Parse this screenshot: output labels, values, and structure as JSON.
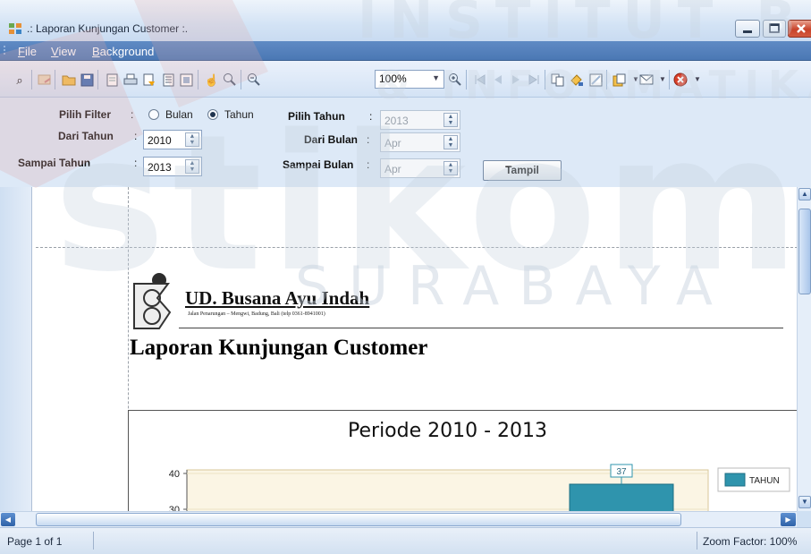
{
  "window": {
    "title": ".: Laporan Kunjungan Customer :.",
    "app_icon": "form-icon"
  },
  "menu": {
    "items": [
      {
        "accel": "F",
        "rest": "ile"
      },
      {
        "accel": "V",
        "rest": "iew"
      },
      {
        "accel": "B",
        "rest": "ackground"
      }
    ]
  },
  "toolbar": {
    "zoom_value": "100%",
    "icons": [
      "find-icon",
      "group-tree-icon",
      "open-icon",
      "save-icon",
      "page-setup-icon",
      "print-icon",
      "quick-print-icon",
      "header-footer-icon",
      "scale-icon",
      "hand-tool-icon",
      "magnifier-icon",
      "zoom-out-icon",
      "zoom-in-icon",
      "first-page-icon",
      "previous-page-icon",
      "next-page-icon",
      "last-page-icon",
      "multiple-pages-icon",
      "background-color-icon",
      "watermark-icon",
      "export-icon",
      "send-email-icon",
      "close-preview-icon"
    ]
  },
  "filter": {
    "filter_label": "Pilih Filter",
    "option_month": "Bulan",
    "option_year": "Tahun",
    "selected_option": "Tahun",
    "from_year_label": "Dari Tahun",
    "from_year_value": "2010",
    "to_year_label": "Sampai Tahun",
    "to_year_value": "2013",
    "pick_year_label": "Pilih Tahun",
    "pick_year_value": "2013",
    "from_month_label": "Dari Bulan",
    "from_month_value": "Apr",
    "to_month_label": "Sampai Bulan",
    "to_month_value": "Apr",
    "show_button": "Tampil"
  },
  "report": {
    "company_name": "UD. Busana Ayu Indah",
    "company_address": "Jalan Penarungan – Mengwi, Badung, Bali (telp 0361-8941001)",
    "title": "Laporan Kunjungan Customer"
  },
  "chart_data": {
    "type": "bar",
    "title": "Periode 2010 - 2013",
    "series": [
      {
        "name": "TAHUN",
        "values": [
          37
        ],
        "color": "#2f94ad"
      }
    ],
    "y_ticks": [
      30,
      40
    ],
    "data_labels": [
      "37"
    ],
    "legend": "top-right"
  },
  "status": {
    "page": "Page 1 of 1",
    "zoom": "Zoom Factor: 100%"
  },
  "watermark": {
    "line1": "INSTITUT BISNIS",
    "line2": "& INFORMATIKA",
    "line3": "stikom",
    "line4": "SURABAYA"
  }
}
